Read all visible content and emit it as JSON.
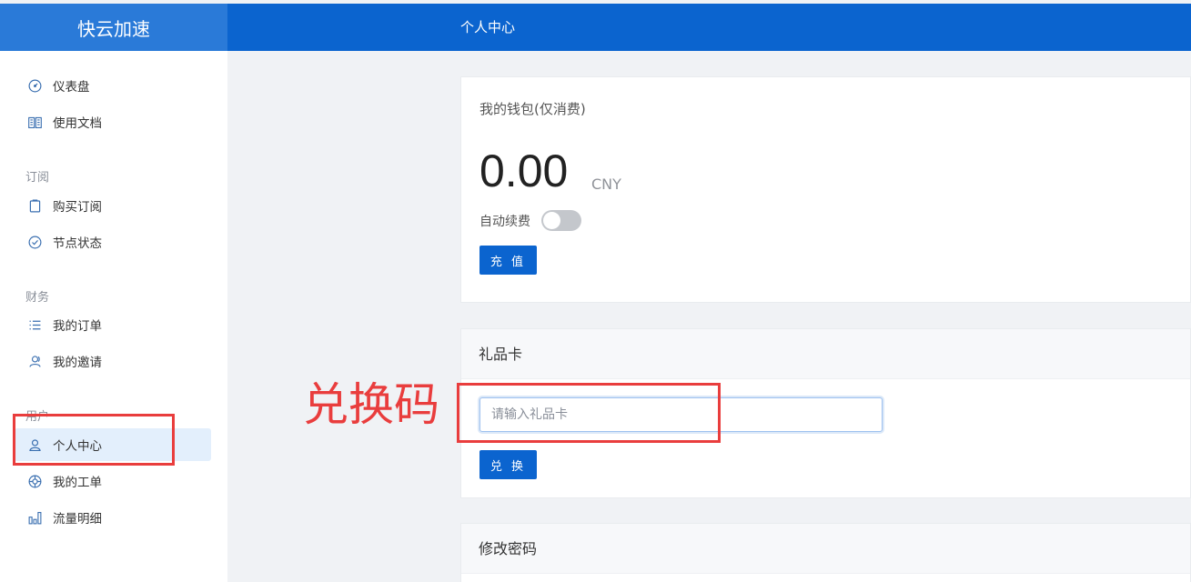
{
  "app": {
    "name": "快云加速"
  },
  "header": {
    "title": "个人中心"
  },
  "sidebar": {
    "items": [
      {
        "label": "仪表盘"
      },
      {
        "label": "使用文档"
      },
      {
        "label": "购买订阅"
      },
      {
        "label": "节点状态"
      },
      {
        "label": "我的订单"
      },
      {
        "label": "我的邀请"
      },
      {
        "label": "个人中心"
      },
      {
        "label": "我的工单"
      },
      {
        "label": "流量明细"
      }
    ],
    "sections": {
      "subscription": "订阅",
      "finance": "财务",
      "user": "用户"
    },
    "active": "个人中心"
  },
  "wallet": {
    "title": "我的钱包(仅消费)",
    "balance": "0.00",
    "currency": "CNY",
    "auto_renew_label": "自动续费",
    "auto_renew_on": false,
    "recharge_label": "充 值"
  },
  "gift_card": {
    "title": "礼品卡",
    "placeholder": "请输入礼品卡",
    "value": "",
    "redeem_label": "兑 换"
  },
  "password": {
    "title": "修改密码"
  },
  "annotation": {
    "text": "兑换码",
    "color": "#e93d3d"
  },
  "colors": {
    "primary": "#0b64cf",
    "logo_bg": "#2a7ad8",
    "active_bg": "#e3effc"
  }
}
